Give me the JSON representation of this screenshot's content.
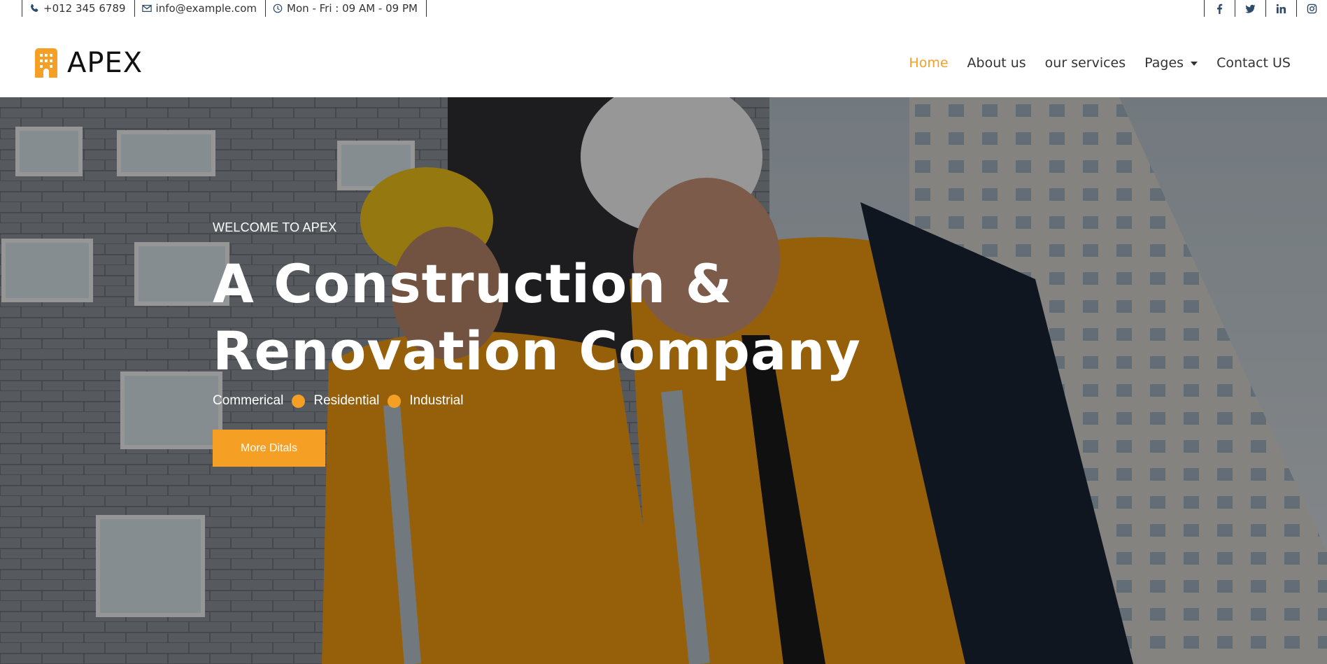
{
  "topbar": {
    "phone": "+012 345 6789",
    "email": "info@example.com",
    "hours": "Mon - Fri : 09 AM - 09 PM",
    "social": [
      "facebook-icon",
      "twitter-icon",
      "linkedin-icon",
      "instagram-icon"
    ]
  },
  "brand": {
    "name": "APEX",
    "icon": "building-icon",
    "accent": "#f5a025"
  },
  "nav": {
    "items": [
      {
        "label": "Home",
        "active": true
      },
      {
        "label": "About us"
      },
      {
        "label": "our services"
      },
      {
        "label": "Pages",
        "dropdown": true
      },
      {
        "label": "Contact US"
      }
    ]
  },
  "hero": {
    "kicker": "WELCOME TO APEX",
    "title": "A Construction & Renovation Company",
    "tags": [
      "Commerical",
      "Residential",
      "Industrial"
    ],
    "button_label": "More Ditals"
  },
  "colors": {
    "accent": "#f5a025",
    "icon": "#2d4a6b",
    "text": "#333333"
  }
}
